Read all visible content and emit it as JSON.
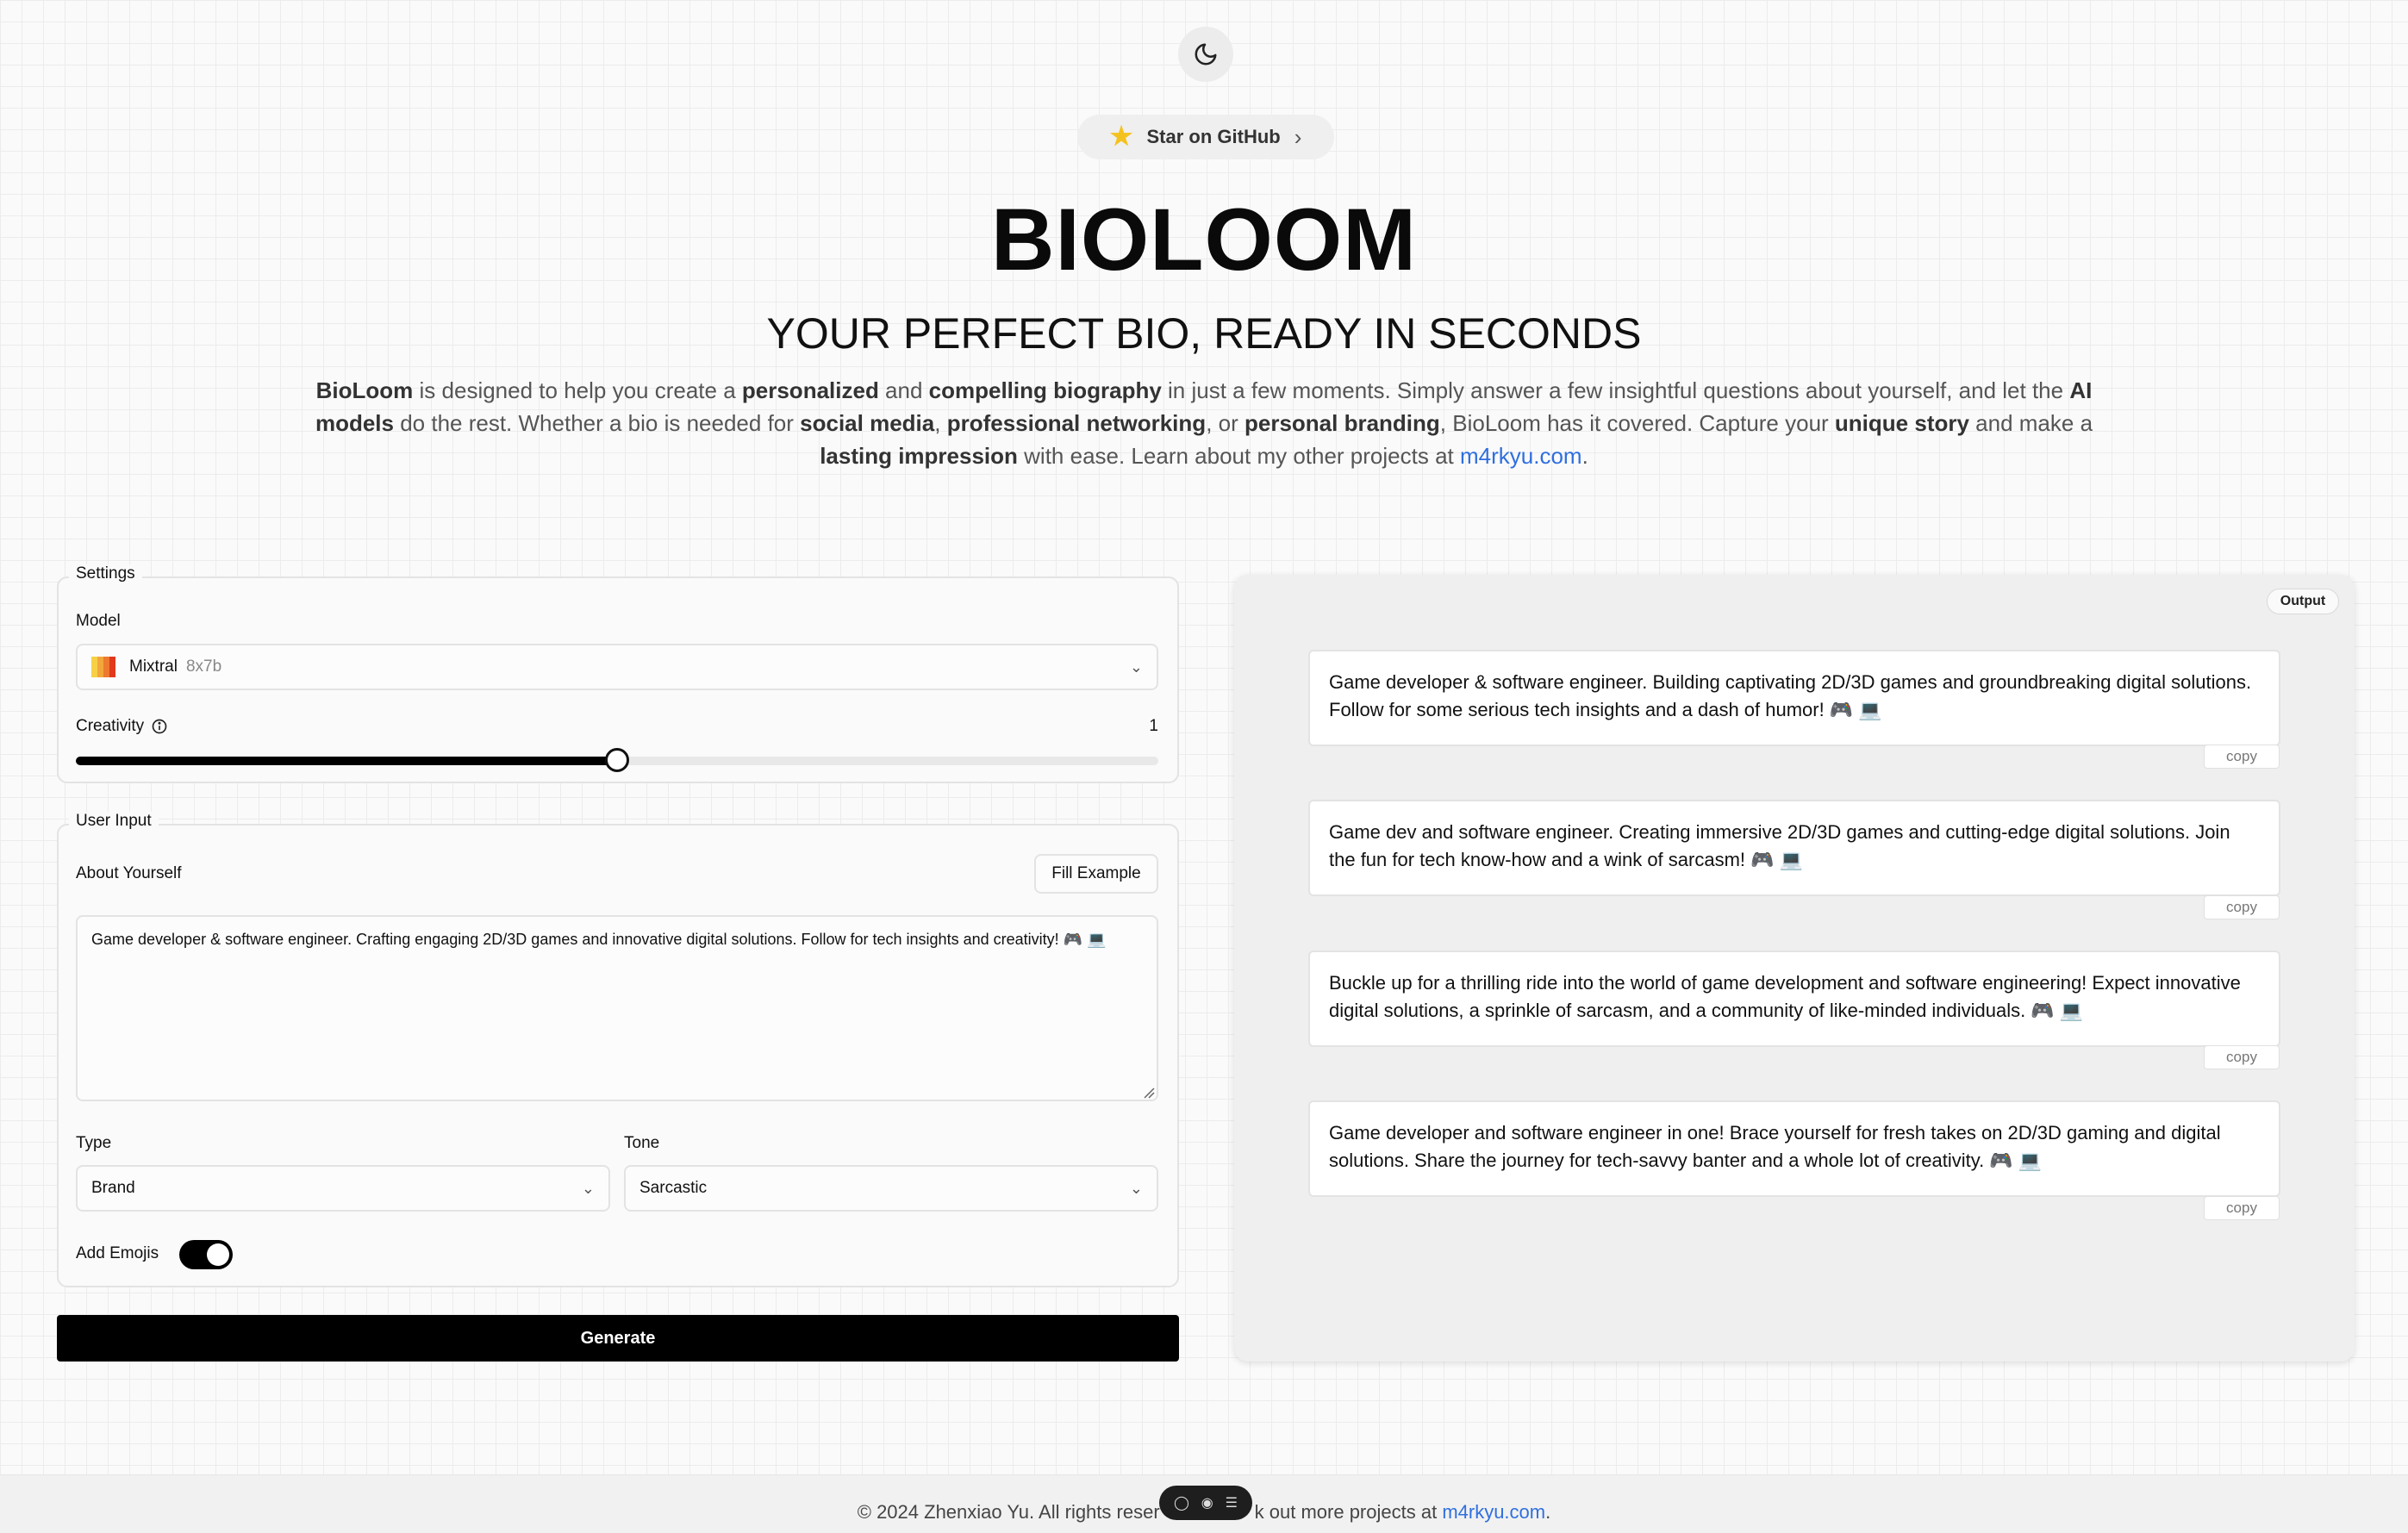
{
  "header": {
    "github_label": "Star on GitHub",
    "title": "BIOLOOM",
    "subtitle": "YOUR PERFECT BIO, READY IN SECONDS",
    "description": {
      "p1": "BioLoom",
      "p2": " is designed to help you create a ",
      "p3": "personalized",
      "p4": " and ",
      "p5": "compelling biography",
      "p6": " in just a few moments. Simply answer a few insightful questions about yourself, and let the ",
      "p7": "AI models",
      "p8": " do the rest. Whether a bio is needed for ",
      "p9": "social media",
      "p10": ", ",
      "p11": "professional networking",
      "p12": ", or ",
      "p13": "personal branding",
      "p14": ", BioLoom has it covered. Capture your ",
      "p15": "unique story",
      "p16": " and make a ",
      "p17": "lasting impression",
      "p18": " with ease. Learn about my other projects at ",
      "link": "m4rkyu.com",
      "end": "."
    }
  },
  "settings": {
    "legend": "Settings",
    "model_label": "Model",
    "model_name": "Mixtral",
    "model_variant": "8x7b",
    "creativity_label": "Creativity",
    "creativity_value": "1",
    "creativity_fraction": 0.5
  },
  "user_input": {
    "legend": "User Input",
    "about_label": "About Yourself",
    "fill_example": "Fill Example",
    "about_text": "Game developer & software engineer. Crafting engaging 2D/3D games and innovative digital solutions. Follow for tech insights and creativity! 🎮 💻",
    "type_label": "Type",
    "type_value": "Brand",
    "tone_label": "Tone",
    "tone_value": "Sarcastic",
    "emojis_label": "Add Emojis",
    "emojis_on": true,
    "generate": "Generate"
  },
  "output": {
    "badge": "Output",
    "copy_label": "copy",
    "bios": [
      "Game developer & software engineer. Building captivating 2D/3D games and groundbreaking digital solutions. Follow for some serious tech insights and a dash of humor! 🎮 💻",
      "Game dev and software engineer. Creating immersive 2D/3D games and cutting-edge digital solutions. Join the fun for tech know-how and a wink of sarcasm! 🎮 💻",
      "Buckle up for a thrilling ride into the world of game development and software engineering! Expect innovative digital solutions, a sprinkle of sarcasm, and a community of like-minded individuals. 🎮 💻",
      "Game developer and software engineer in one! Brace yourself for fresh takes on 2D/3D gaming and digital solutions. Share the journey for tech-savvy banter and a whole lot of creativity. 🎮 💻"
    ]
  },
  "footer": {
    "text_left": "© 2024 Zhenxiao Yu. All rights reser",
    "text_right": "k out more projects at ",
    "link": "m4rkyu.com",
    "end": "."
  },
  "colors": {
    "accent_link": "#2f6fdf",
    "primary": "#000000"
  }
}
